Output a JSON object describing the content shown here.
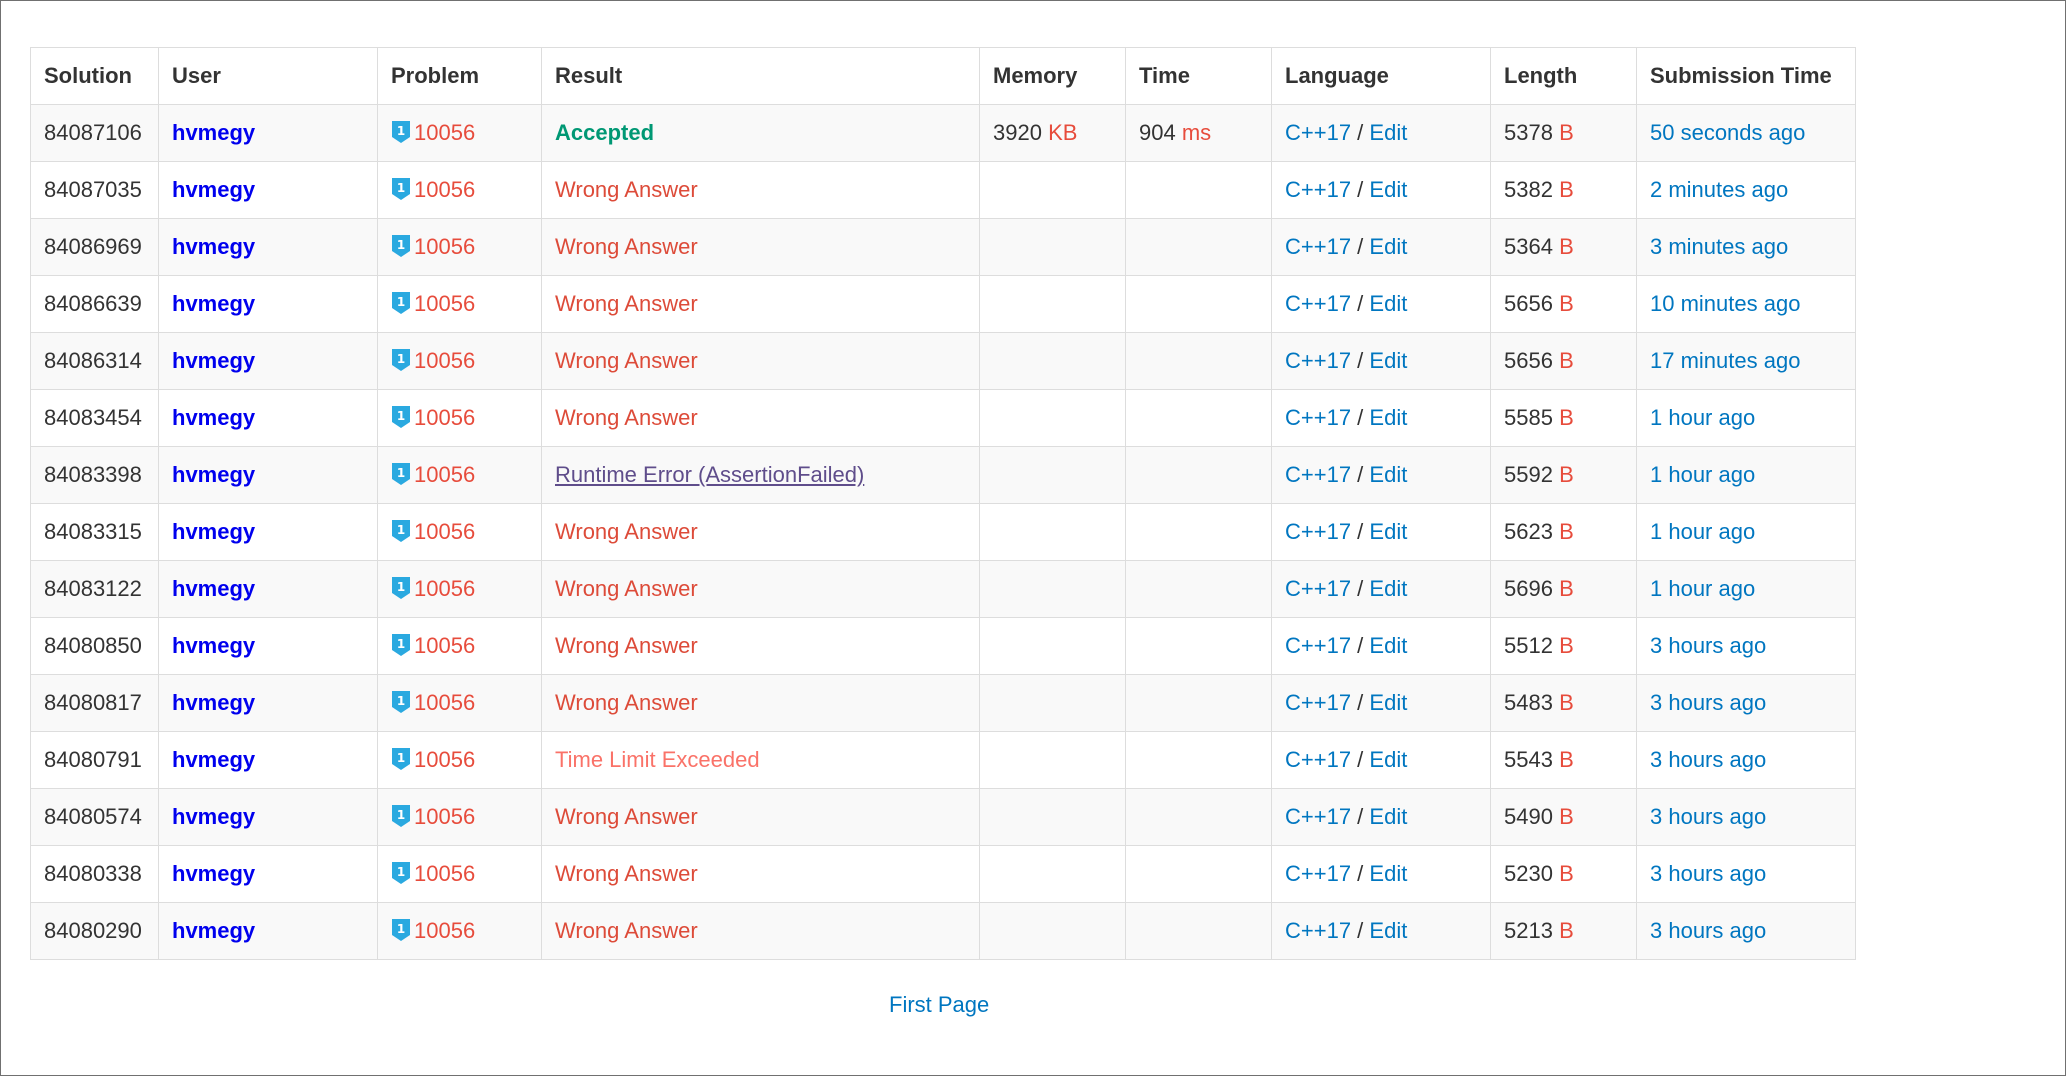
{
  "table": {
    "headers": [
      "Solution",
      "User",
      "Problem",
      "Result",
      "Memory",
      "Time",
      "Language",
      "Length",
      "Submission Time"
    ],
    "rows": [
      {
        "solution": "84087106",
        "user": "hvmegy",
        "problem": "10056",
        "result": "Accepted",
        "result_kind": "ac",
        "memory": "3920",
        "memory_unit": "KB",
        "time": "904",
        "time_unit": "ms",
        "language": "C++17",
        "edit": "Edit",
        "length": "5378",
        "length_unit": "B",
        "submitted": "50 seconds ago"
      },
      {
        "solution": "84087035",
        "user": "hvmegy",
        "problem": "10056",
        "result": "Wrong Answer",
        "result_kind": "wa",
        "memory": "",
        "memory_unit": "",
        "time": "",
        "time_unit": "",
        "language": "C++17",
        "edit": "Edit",
        "length": "5382",
        "length_unit": "B",
        "submitted": "2 minutes ago"
      },
      {
        "solution": "84086969",
        "user": "hvmegy",
        "problem": "10056",
        "result": "Wrong Answer",
        "result_kind": "wa",
        "memory": "",
        "memory_unit": "",
        "time": "",
        "time_unit": "",
        "language": "C++17",
        "edit": "Edit",
        "length": "5364",
        "length_unit": "B",
        "submitted": "3 minutes ago"
      },
      {
        "solution": "84086639",
        "user": "hvmegy",
        "problem": "10056",
        "result": "Wrong Answer",
        "result_kind": "wa",
        "memory": "",
        "memory_unit": "",
        "time": "",
        "time_unit": "",
        "language": "C++17",
        "edit": "Edit",
        "length": "5656",
        "length_unit": "B",
        "submitted": "10 minutes ago"
      },
      {
        "solution": "84086314",
        "user": "hvmegy",
        "problem": "10056",
        "result": "Wrong Answer",
        "result_kind": "wa",
        "memory": "",
        "memory_unit": "",
        "time": "",
        "time_unit": "",
        "language": "C++17",
        "edit": "Edit",
        "length": "5656",
        "length_unit": "B",
        "submitted": "17 minutes ago"
      },
      {
        "solution": "84083454",
        "user": "hvmegy",
        "problem": "10056",
        "result": "Wrong Answer",
        "result_kind": "wa",
        "memory": "",
        "memory_unit": "",
        "time": "",
        "time_unit": "",
        "language": "C++17",
        "edit": "Edit",
        "length": "5585",
        "length_unit": "B",
        "submitted": "1 hour ago"
      },
      {
        "solution": "84083398",
        "user": "hvmegy",
        "problem": "10056",
        "result": "Runtime Error (AssertionFailed)",
        "result_kind": "rte",
        "memory": "",
        "memory_unit": "",
        "time": "",
        "time_unit": "",
        "language": "C++17",
        "edit": "Edit",
        "length": "5592",
        "length_unit": "B",
        "submitted": "1 hour ago"
      },
      {
        "solution": "84083315",
        "user": "hvmegy",
        "problem": "10056",
        "result": "Wrong Answer",
        "result_kind": "wa",
        "memory": "",
        "memory_unit": "",
        "time": "",
        "time_unit": "",
        "language": "C++17",
        "edit": "Edit",
        "length": "5623",
        "length_unit": "B",
        "submitted": "1 hour ago"
      },
      {
        "solution": "84083122",
        "user": "hvmegy",
        "problem": "10056",
        "result": "Wrong Answer",
        "result_kind": "wa",
        "memory": "",
        "memory_unit": "",
        "time": "",
        "time_unit": "",
        "language": "C++17",
        "edit": "Edit",
        "length": "5696",
        "length_unit": "B",
        "submitted": "1 hour ago"
      },
      {
        "solution": "84080850",
        "user": "hvmegy",
        "problem": "10056",
        "result": "Wrong Answer",
        "result_kind": "wa",
        "memory": "",
        "memory_unit": "",
        "time": "",
        "time_unit": "",
        "language": "C++17",
        "edit": "Edit",
        "length": "5512",
        "length_unit": "B",
        "submitted": "3 hours ago"
      },
      {
        "solution": "84080817",
        "user": "hvmegy",
        "problem": "10056",
        "result": "Wrong Answer",
        "result_kind": "wa",
        "memory": "",
        "memory_unit": "",
        "time": "",
        "time_unit": "",
        "language": "C++17",
        "edit": "Edit",
        "length": "5483",
        "length_unit": "B",
        "submitted": "3 hours ago"
      },
      {
        "solution": "84080791",
        "user": "hvmegy",
        "problem": "10056",
        "result": "Time Limit Exceeded",
        "result_kind": "tle",
        "memory": "",
        "memory_unit": "",
        "time": "",
        "time_unit": "",
        "language": "C++17",
        "edit": "Edit",
        "length": "5543",
        "length_unit": "B",
        "submitted": "3 hours ago"
      },
      {
        "solution": "84080574",
        "user": "hvmegy",
        "problem": "10056",
        "result": "Wrong Answer",
        "result_kind": "wa",
        "memory": "",
        "memory_unit": "",
        "time": "",
        "time_unit": "",
        "language": "C++17",
        "edit": "Edit",
        "length": "5490",
        "length_unit": "B",
        "submitted": "3 hours ago"
      },
      {
        "solution": "84080338",
        "user": "hvmegy",
        "problem": "10056",
        "result": "Wrong Answer",
        "result_kind": "wa",
        "memory": "",
        "memory_unit": "",
        "time": "",
        "time_unit": "",
        "language": "C++17",
        "edit": "Edit",
        "length": "5230",
        "length_unit": "B",
        "submitted": "3 hours ago"
      },
      {
        "solution": "84080290",
        "user": "hvmegy",
        "problem": "10056",
        "result": "Wrong Answer",
        "result_kind": "wa",
        "memory": "",
        "memory_unit": "",
        "time": "",
        "time_unit": "",
        "language": "C++17",
        "edit": "Edit",
        "length": "5213",
        "length_unit": "B",
        "submitted": "3 hours ago"
      }
    ]
  },
  "pager": {
    "first_page": "First Page"
  },
  "icons": {
    "problem_tier": "tier-badge-icon"
  },
  "colors": {
    "accepted": "#009874",
    "wrong_answer": "#dd4b39",
    "runtime_error": "#5f4d8b",
    "time_limit": "#fa7268",
    "link": "#0076c0",
    "user": "#0000ee",
    "tier_badge": "#2aa9e0"
  }
}
